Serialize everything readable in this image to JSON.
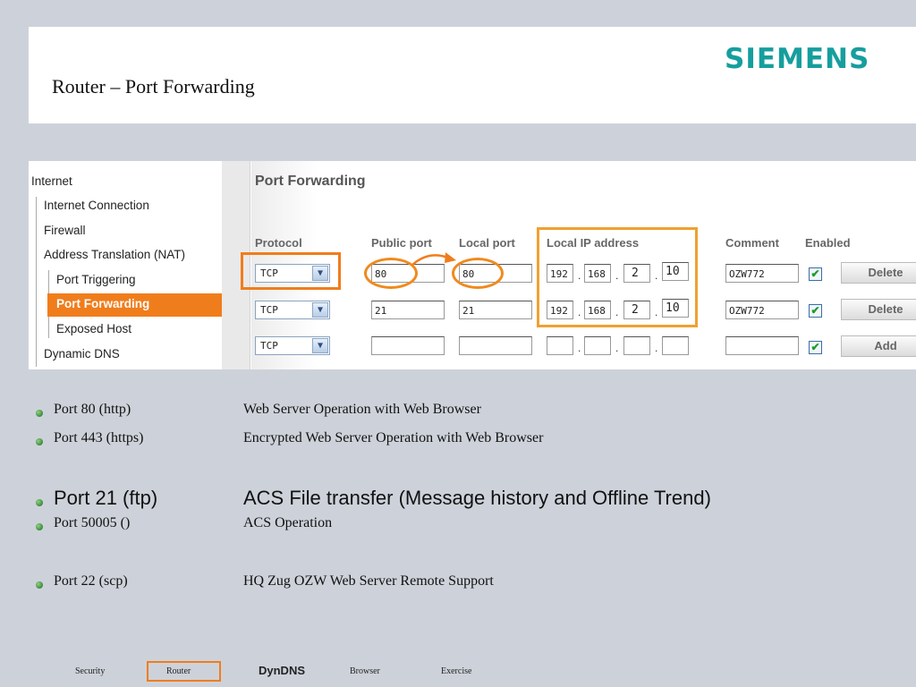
{
  "slide": {
    "title": "Router – Port Forwarding",
    "logo": "SIEMENS"
  },
  "nav": {
    "items": [
      {
        "label": "Internet"
      },
      {
        "label": "Internet Connection"
      },
      {
        "label": "Firewall"
      },
      {
        "label": "Address Translation (NAT)"
      },
      {
        "label": "Port Triggering"
      },
      {
        "label": "Port Forwarding",
        "active": true
      },
      {
        "label": "Exposed Host"
      },
      {
        "label": "Dynamic DNS"
      }
    ]
  },
  "panel": {
    "title": "Port Forwarding",
    "columns": [
      "Protocol",
      "Public port",
      "Local port",
      "Local IP address",
      "Comment",
      "Enabled"
    ],
    "rows": [
      {
        "protocol": "TCP",
        "public_port": "80",
        "local_port": "80",
        "ip": [
          "192",
          "168",
          "2",
          "10"
        ],
        "comment": "OZW772",
        "enabled": true,
        "action": "Delete"
      },
      {
        "protocol": "TCP",
        "public_port": "21",
        "local_port": "21",
        "ip": [
          "192",
          "168",
          "2",
          "10"
        ],
        "comment": "OZW772",
        "enabled": true,
        "action": "Delete"
      },
      {
        "protocol": "TCP",
        "public_port": "",
        "local_port": "",
        "ip": [
          "",
          "",
          "",
          ""
        ],
        "comment": "",
        "enabled": true,
        "action": "Add"
      }
    ],
    "ip_separator": ".",
    "checkmark": "✔",
    "dropdown_arrow": "▼",
    "highlight_color": "#f07d1c"
  },
  "bullets": [
    {
      "port": "Port 80 (http)",
      "desc": "Web Server Operation with Web Browser"
    },
    {
      "port": "Port 443 (https)",
      "desc": "Encrypted Web Server Operation with Web Browser"
    },
    {
      "port": "Port 21 (ftp)",
      "desc": "ACS File transfer (Message history and Offline Trend)"
    },
    {
      "port": "Port 50005 ()",
      "desc": "ACS Operation"
    },
    {
      "port": "Port 22 (scp)",
      "desc": "HQ Zug OZW Web Server Remote Support"
    }
  ],
  "bottom_nav": [
    {
      "label": "Security"
    },
    {
      "label": "Router",
      "active": true
    },
    {
      "label": "DynDNS"
    },
    {
      "label": "Browser"
    },
    {
      "label": "Exercise"
    }
  ]
}
